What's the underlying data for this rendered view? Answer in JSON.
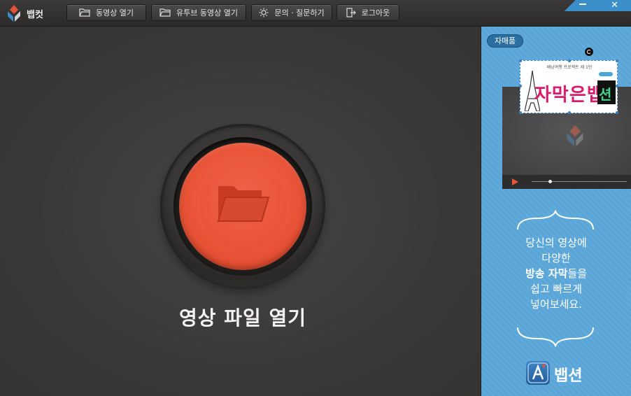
{
  "app": {
    "name": "뱁컷"
  },
  "toolbar": {
    "open_video": "동영상 열기",
    "open_youtube": "유투브 동영상 열기",
    "inquiry": "문의 · 질문하기",
    "logout": "로그아웃"
  },
  "main": {
    "open_file_label": "영상 파일 열기"
  },
  "side": {
    "badge": "자매품",
    "subtitle_sample": {
      "top_text": "배낭여행 프로젝트 제 1탄",
      "main_text": "자막은뱁",
      "corner_text": "션"
    },
    "promo": {
      "line1": "당신의 영상에",
      "line2": "다양한",
      "line3_bold": "방송 자막",
      "line3_rest": "들을",
      "line4": "쉽고 빠르게",
      "line5": "넣어보세요."
    },
    "brand": "뱁션"
  },
  "colors": {
    "accent_red": "#ea5538",
    "side_blue": "#5aa6d8",
    "background": "#3a3837"
  },
  "icons": [
    "app-logo-icon",
    "folder-icon",
    "lightbulb-icon",
    "exit-icon",
    "minimize-icon",
    "close-icon",
    "play-icon",
    "rotate-icon"
  ]
}
